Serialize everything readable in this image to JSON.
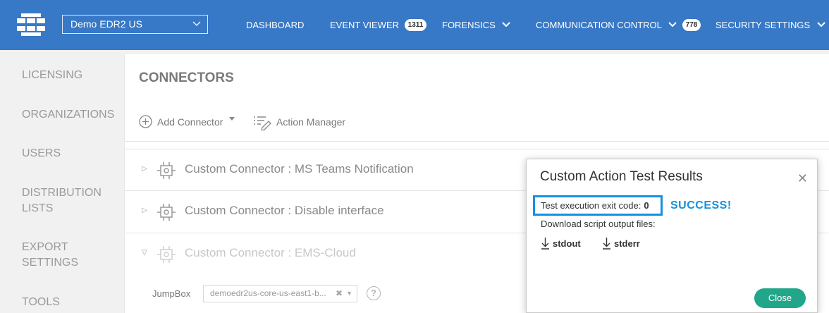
{
  "header": {
    "org_selector": "Demo EDR2 US",
    "nav": {
      "dashboard": "DASHBOARD",
      "event_viewer": "EVENT VIEWER",
      "event_viewer_count": "1311",
      "forensics": "FORENSICS",
      "communication_control": "COMMUNICATION CONTROL",
      "communication_control_count": "778",
      "security_settings": "SECURITY SETTINGS"
    },
    "bar_color": "#3778c7"
  },
  "sidebar": {
    "items": [
      "LICENSING",
      "ORGANIZATIONS",
      "USERS",
      "DISTRIBUTION",
      "LISTS",
      "EXPORT",
      "SETTINGS",
      "TOOLS"
    ]
  },
  "main": {
    "title": "CONNECTORS",
    "toolbar": {
      "add_connector": "Add Connector",
      "action_manager": "Action Manager"
    },
    "connectors": [
      {
        "label": "Custom Connector : MS Teams Notification"
      },
      {
        "label": "Custom Connector : Disable interface"
      },
      {
        "label": "Custom Connector : EMS-Cloud"
      }
    ],
    "jumpbox": {
      "label": "JumpBox",
      "value": "demoedr2us-core-us-east1-b..."
    }
  },
  "dialog": {
    "title": "Custom Action Test Results",
    "exit_code_label": "Test execution exit code:",
    "exit_code_value": "0",
    "status": "SUCCESS!",
    "download_label": "Download script output files:",
    "stdout": "stdout",
    "stderr": "stderr",
    "close_label": "Close",
    "accent_color": "#1591dd",
    "button_color": "#22a68a"
  }
}
